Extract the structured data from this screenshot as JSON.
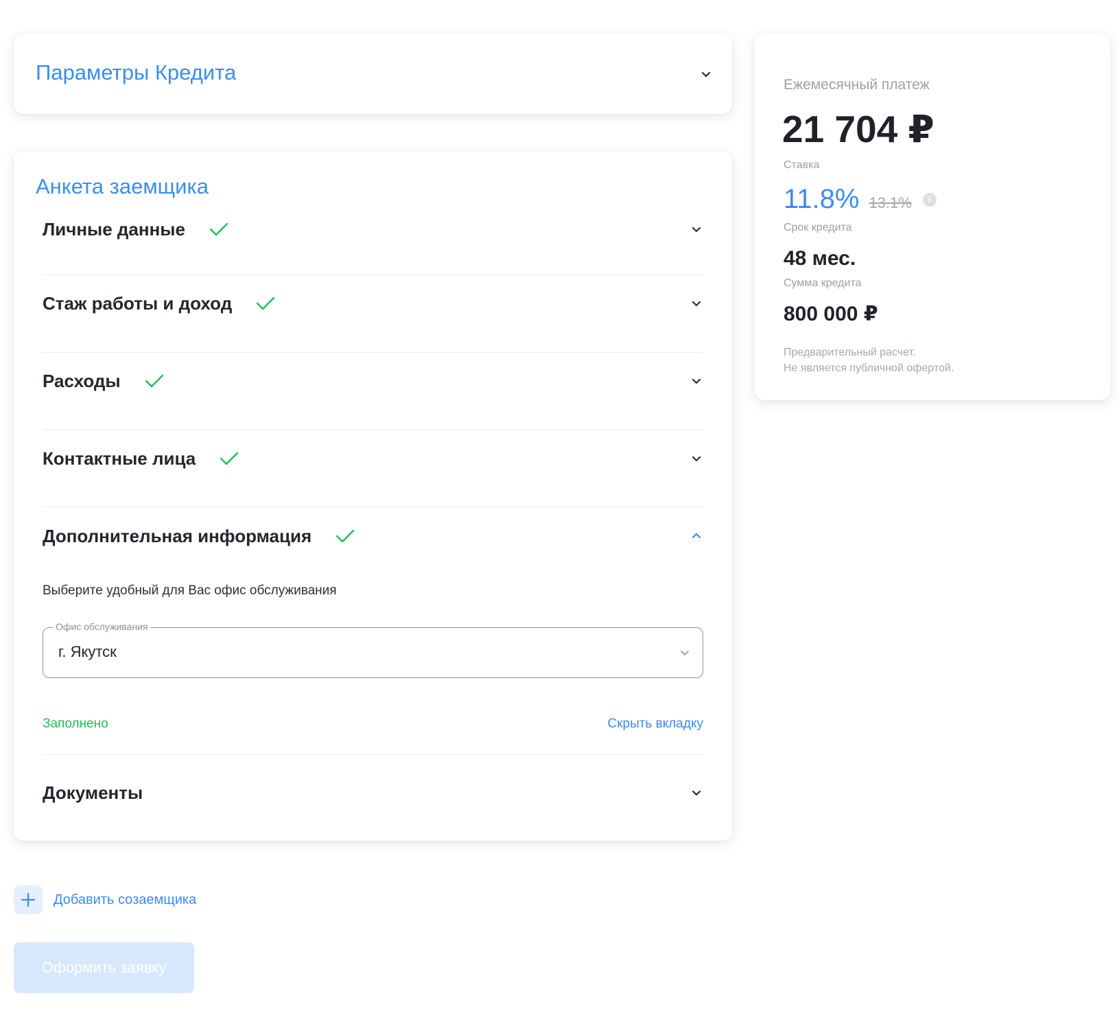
{
  "params": {
    "title": "Параметры Кредита"
  },
  "form": {
    "title": "Анкета заемщика",
    "sections": [
      {
        "label": "Личные данные",
        "completed": true,
        "expanded": false
      },
      {
        "label": "Стаж работы и доход",
        "completed": true,
        "expanded": false
      },
      {
        "label": "Расходы",
        "completed": true,
        "expanded": false
      },
      {
        "label": "Контактные лица",
        "completed": true,
        "expanded": false
      },
      {
        "label": "Дополнительная информация",
        "completed": true,
        "expanded": true
      },
      {
        "label": "Документы",
        "completed": false,
        "expanded": false
      }
    ],
    "additional": {
      "subtitle": "Выберите удобный для Вас офис обслуживания",
      "office_field_label": "Офис обслуживания",
      "office_value": "г. Якутск",
      "status": "Заполнено",
      "hide_tab": "Скрыть вкладку"
    }
  },
  "add_coborrower": "Добавить созаемщика",
  "submit": "Оформить заявку",
  "summary": {
    "payment_label": "Ежемесячный платеж",
    "payment_value": "21 704 ₽",
    "rate_label": "Ставка",
    "rate_new": "11.8%",
    "rate_old": "13.1%",
    "term_label": "Срок кредита",
    "term_value": "48 мес.",
    "amount_label": "Сумма кредита",
    "amount_value": "800 000 ₽",
    "disclaimer_line1": "Предварительный расчет.",
    "disclaimer_line2": "Не является публичной офертой."
  },
  "colors": {
    "accent": "#3b8cf0",
    "success": "#1ebe55",
    "button_disabled_bg": "#d7e8fd"
  }
}
